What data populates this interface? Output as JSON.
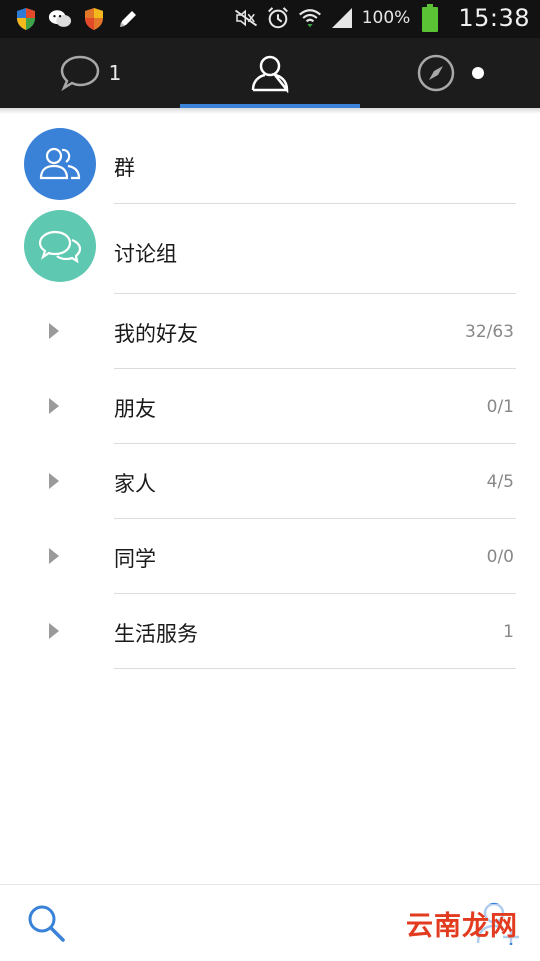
{
  "status_bar": {
    "battery_percent": "100%",
    "time": "15:38",
    "left_icons": [
      "security-shield-icon",
      "wechat-icon",
      "security-shield-icon",
      "edit-pen-icon"
    ],
    "right_icons": [
      "mute-icon",
      "alarm-icon",
      "wifi-icon",
      "signal-icon",
      "battery-icon"
    ]
  },
  "top_nav": {
    "messages_badge": "1",
    "active_tab": "contacts"
  },
  "groups": [
    {
      "label": "群",
      "icon": "group-icon",
      "color": "#3a82d8"
    },
    {
      "label": "讨论组",
      "icon": "discussion-icon",
      "color": "#5ec8b0"
    }
  ],
  "friend_groups": [
    {
      "label": "我的好友",
      "count": "32/63"
    },
    {
      "label": "朋友",
      "count": "0/1"
    },
    {
      "label": "家人",
      "count": "4/5"
    },
    {
      "label": "同学",
      "count": "0/0"
    },
    {
      "label": "生活服务",
      "count": "1"
    }
  ],
  "watermark": "云南龙网",
  "colors": {
    "accent": "#3a82d8",
    "nav_bg": "#1c1c1c",
    "status_bg": "#121212"
  }
}
